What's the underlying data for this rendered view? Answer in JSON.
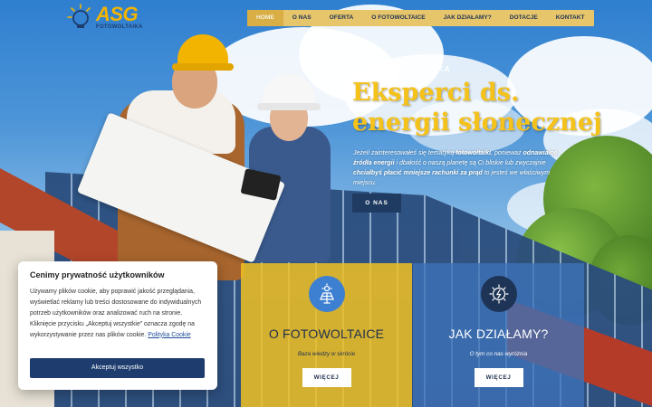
{
  "logo": {
    "main": "ASG",
    "sub": "FOTOWOLTAIKA"
  },
  "nav": {
    "items": [
      "HOME",
      "O NAS",
      "OFERTA",
      "O FOTOWOLTAICE",
      "JAK DZIAŁAMY?",
      "DOTACJE",
      "KONTAKT"
    ],
    "active_index": 0
  },
  "hero": {
    "eyebrow": "ASG FOTOWOLTAIKA",
    "headline_line1": "Eksperci ds.",
    "headline_line2": "energii słonecznej",
    "lead_parts": {
      "p1": "Jeżeli zainteresowałeś się tematyką ",
      "b1": "fotowoltaiki",
      "p2": ", ponieważ ",
      "b2": "odnawialne źródła energii",
      "p3": " i dbałość o naszą planetę są Ci bliskie lub zwyczajnie ",
      "b3": "chciałbyś płacić mniejsze rachunki za prąd",
      "p4": " to jesteś we właściwym miejscu."
    },
    "button": "O NAS"
  },
  "panels": [
    {
      "title": "O FOTOWOLTAICE",
      "subtitle": "Baza wiedzy w skrócie",
      "button": "WIĘCEJ",
      "icon": "solar-panel-icon"
    },
    {
      "title": "JAK DZIAŁAMY?",
      "subtitle": "O tym co nas wyróżnia",
      "button": "WIĘCEJ",
      "icon": "bulb-icon"
    }
  ],
  "cookie": {
    "title": "Cenimy prywatność użytkowników",
    "text": "Używamy plików cookie, aby poprawić jakość przeglądania, wyświetlać reklamy lub treści dostosowane do indywidualnych potrzeb użytkowników oraz analizować ruch na stronie. Kliknięcie przycisku „Akceptuj wszystkie” oznacza zgodę na wykorzystywanie przez nas plików cookie. ",
    "link": "Polityka Cookie",
    "button": "Akceptuj wszystko"
  },
  "colors": {
    "accent_yellow": "#f2b400",
    "navy": "#1e3d6e",
    "nav_bg": "#e7c56a",
    "panel_blue": "#3e72b9"
  }
}
